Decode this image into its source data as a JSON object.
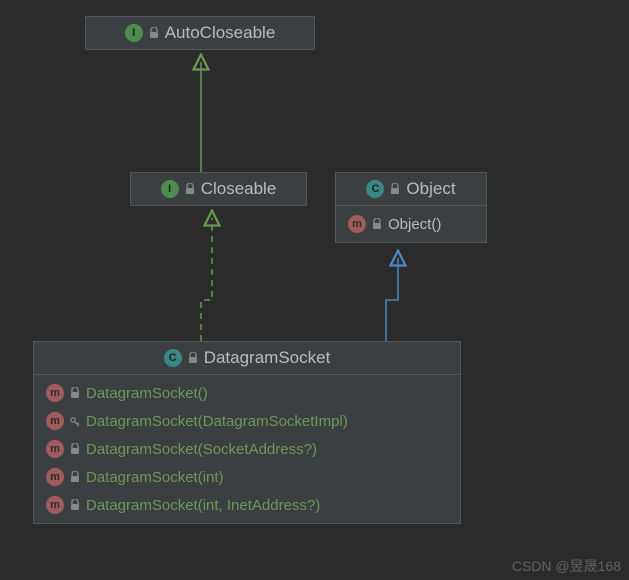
{
  "chart_data": {
    "type": "diagram",
    "title": "",
    "nodes": [
      {
        "id": "autocloseable",
        "kind": "interface",
        "label": "AutoCloseable",
        "members": []
      },
      {
        "id": "closeable",
        "kind": "interface",
        "label": "Closeable",
        "members": []
      },
      {
        "id": "object",
        "kind": "class",
        "label": "Object",
        "members": [
          {
            "kind": "method",
            "label": "Object()"
          }
        ]
      },
      {
        "id": "datagramsocket",
        "kind": "class",
        "label": "DatagramSocket",
        "members": [
          {
            "kind": "method",
            "label": "DatagramSocket()"
          },
          {
            "kind": "method",
            "label": "DatagramSocket(DatagramSocketImpl)",
            "visibility": "protected"
          },
          {
            "kind": "method",
            "label": "DatagramSocket(SocketAddress?)"
          },
          {
            "kind": "method",
            "label": "DatagramSocket(int)"
          },
          {
            "kind": "method",
            "label": "DatagramSocket(int, InetAddress?)"
          }
        ]
      }
    ],
    "edges": [
      {
        "from": "closeable",
        "to": "autocloseable",
        "style": "implements"
      },
      {
        "from": "datagramsocket",
        "to": "closeable",
        "style": "implements-dashed"
      },
      {
        "from": "datagramsocket",
        "to": "object",
        "style": "extends"
      }
    ]
  },
  "nodes": {
    "autocloseable": {
      "badge": "I",
      "title": "AutoCloseable"
    },
    "closeable": {
      "badge": "I",
      "title": "Closeable"
    },
    "object": {
      "badge": "C",
      "title": "Object",
      "member0_badge": "m",
      "member0": "Object()"
    },
    "datagramsocket": {
      "badge": "C",
      "title": "DatagramSocket",
      "m0_badge": "m",
      "m0": "DatagramSocket()",
      "m1_badge": "m",
      "m1": "DatagramSocket(DatagramSocketImpl)",
      "m2_badge": "m",
      "m2": "DatagramSocket(SocketAddress?)",
      "m3_badge": "m",
      "m3": "DatagramSocket(int)",
      "m4_badge": "m",
      "m4": "DatagramSocket(int, InetAddress?)"
    }
  },
  "watermark": "CSDN @昱晟168"
}
